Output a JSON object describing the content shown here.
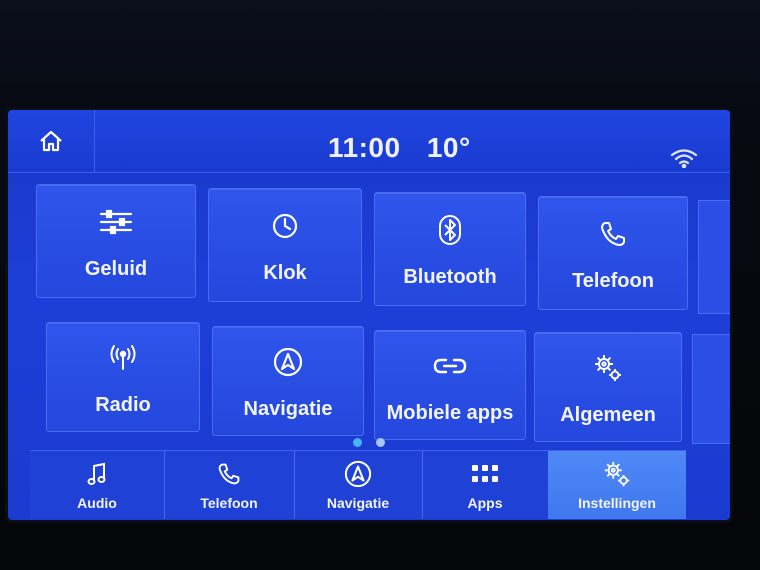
{
  "header": {
    "time": "11:00",
    "temperature": "10°"
  },
  "tiles": [
    {
      "label": "Geluid",
      "icon": "equalizer-icon"
    },
    {
      "label": "Klok",
      "icon": "clock-icon"
    },
    {
      "label": "Bluetooth",
      "icon": "bluetooth-icon"
    },
    {
      "label": "Telefoon",
      "icon": "phone-icon"
    },
    {
      "label": "Radio",
      "icon": "radio-antenna-icon"
    },
    {
      "label": "Navigatie",
      "icon": "navigation-icon"
    },
    {
      "label": "Mobiele apps",
      "icon": "link-icon"
    },
    {
      "label": "Algemeen",
      "icon": "gears-icon"
    }
  ],
  "pager": {
    "pages": 2,
    "current": 1
  },
  "bottom_nav": [
    {
      "label": "Audio",
      "icon": "music-note-icon",
      "active": false
    },
    {
      "label": "Telefoon",
      "icon": "phone-icon",
      "active": false
    },
    {
      "label": "Navigatie",
      "icon": "navigation-icon",
      "active": false
    },
    {
      "label": "Apps",
      "icon": "grid-icon",
      "active": false
    },
    {
      "label": "Instellingen",
      "icon": "gears-icon",
      "active": true
    }
  ],
  "colors": {
    "screen_bg": "#1d3fd8",
    "tile_bg": "#2a4ee6",
    "active_tab": "#4a84f4",
    "dot_active": "#47b6ff",
    "dot_inactive": "#a9c4ff"
  }
}
